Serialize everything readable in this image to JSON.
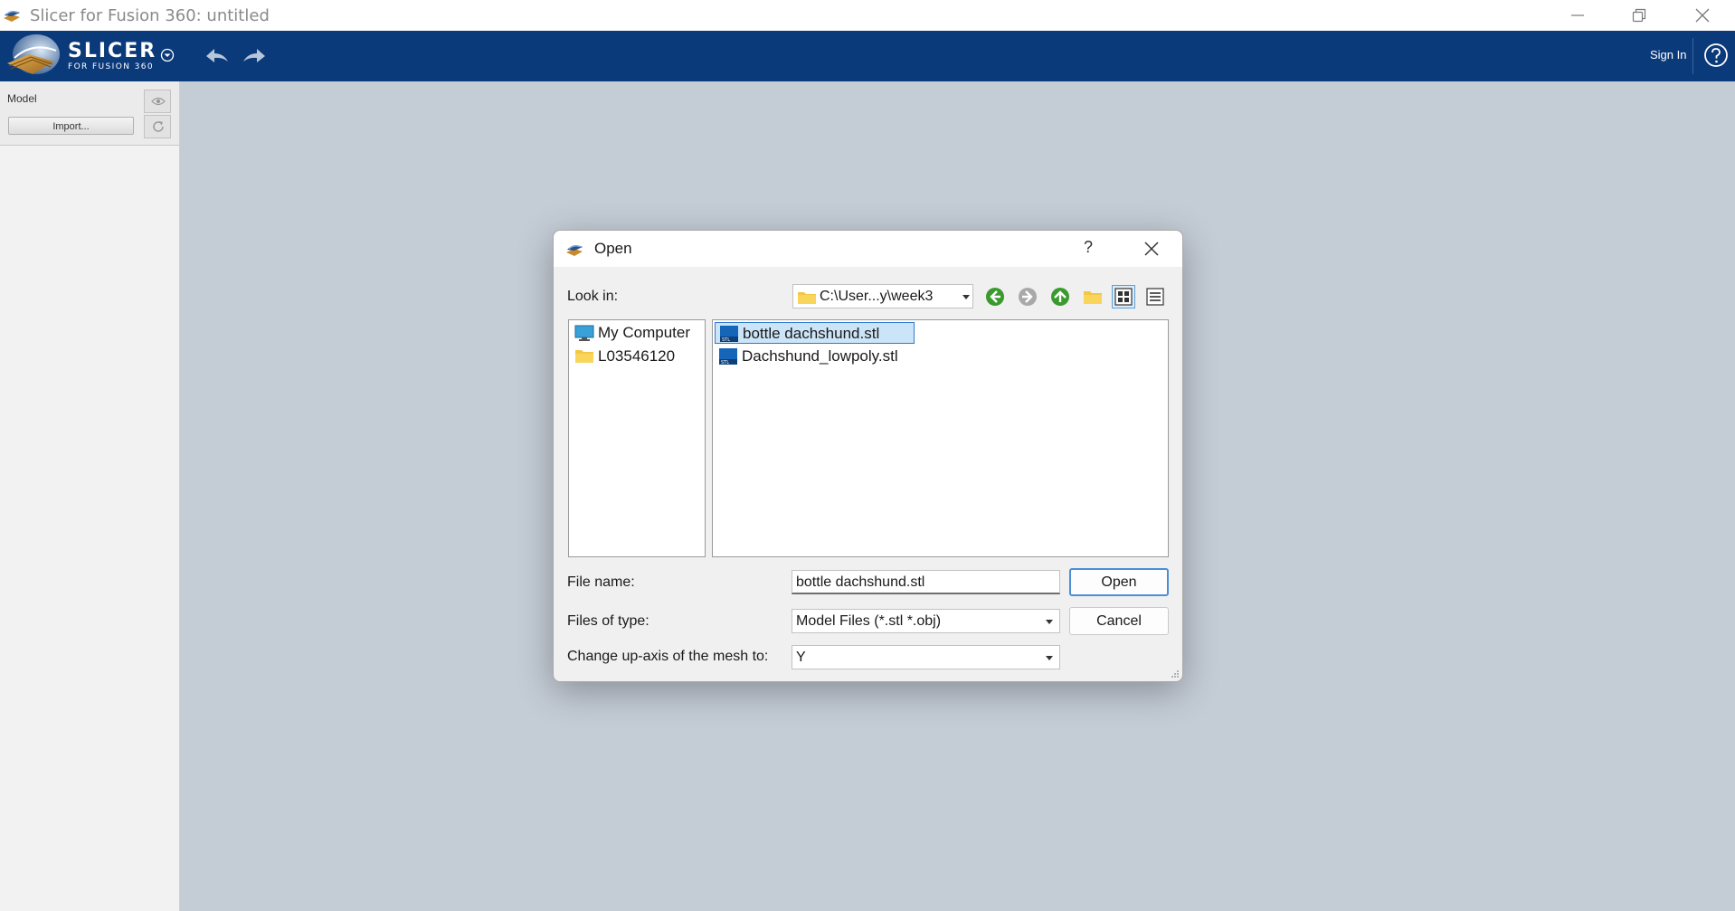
{
  "window": {
    "title": "Slicer for Fusion 360: untitled"
  },
  "header": {
    "logo_text": "SLICER",
    "logo_sub": "FOR FUSION 360",
    "sign_in": "Sign In",
    "icons": [
      "logo-mark",
      "dropdown-chevron",
      "undo-arrow",
      "redo-arrow",
      "help-circle"
    ]
  },
  "left_panel": {
    "section_label": "Model",
    "import_button": "Import...",
    "icons": [
      "eye-icon",
      "refresh-icon"
    ]
  },
  "dialog": {
    "title": "Open",
    "help_glyph": "?",
    "look_in_label": "Look in:",
    "look_in_value": "C:\\User...y\\week3",
    "places": [
      {
        "label": "My Computer",
        "icon": "computer-icon"
      },
      {
        "label": "L03546120",
        "icon": "folder-icon"
      }
    ],
    "files": [
      {
        "name": "bottle dachshund.stl",
        "icon": "stl-file-icon",
        "selected": true
      },
      {
        "name": "Dachshund_lowpoly.stl",
        "icon": "stl-file-icon",
        "selected": false
      }
    ],
    "file_name_label": "File name:",
    "file_name_value": "bottle dachshund.stl",
    "files_of_type_label": "Files of type:",
    "files_of_type_value": "Model Files (*.stl *.obj)",
    "up_axis_label": "Change up-axis of the mesh to:",
    "up_axis_value": "Y",
    "open_button": "Open",
    "cancel_button": "Cancel",
    "view_mode": "list",
    "colors": {
      "selection_bg": "#cce4f7",
      "selection_border": "#2f7bd0",
      "nav_green": "#3a9a2e",
      "header_blue": "#0b3a7a"
    }
  }
}
